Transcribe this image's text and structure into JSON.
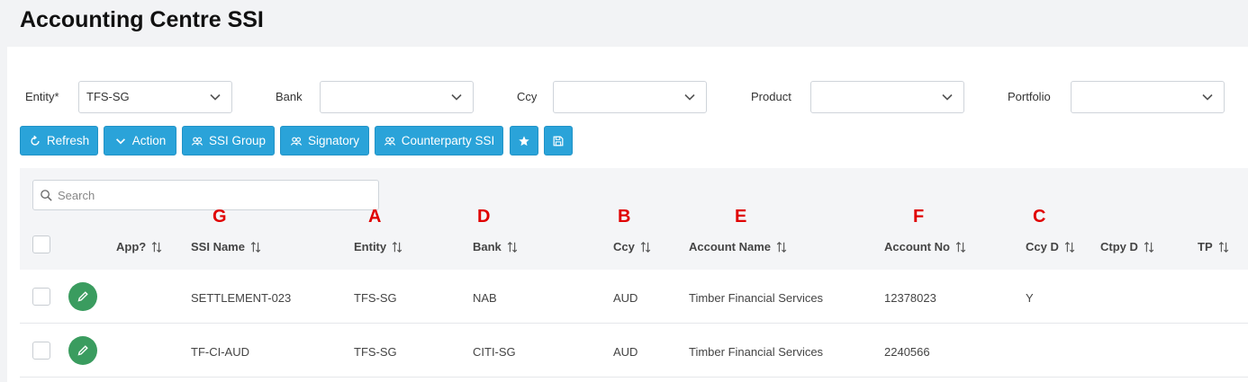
{
  "page": {
    "title": "Accounting Centre SSI"
  },
  "filters": {
    "entity": {
      "label": "Entity*",
      "value": "TFS-SG"
    },
    "bank": {
      "label": "Bank",
      "value": ""
    },
    "ccy": {
      "label": "Ccy",
      "value": ""
    },
    "product": {
      "label": "Product",
      "value": ""
    },
    "portfolio": {
      "label": "Portfolio",
      "value": ""
    }
  },
  "toolbar": {
    "refresh": "Refresh",
    "action": "Action",
    "ssi_group": "SSI Group",
    "signatory": "Signatory",
    "counterparty_ssi": "Counterparty SSI"
  },
  "search": {
    "placeholder": "Search"
  },
  "annotations": {
    "ssi_name": "G",
    "entity": "A",
    "bank": "D",
    "ccy": "B",
    "account_name": "E",
    "account_no": "F",
    "ccy_d": "C"
  },
  "table": {
    "columns": {
      "app": "App?",
      "ssi_name": "SSI Name",
      "entity": "Entity",
      "bank": "Bank",
      "ccy": "Ccy",
      "account_name": "Account Name",
      "account_no": "Account No",
      "ccy_d": "Ccy D",
      "ctpy_d": "Ctpy D",
      "tp": "TP"
    },
    "rows": [
      {
        "ssi_name": "SETTLEMENT-023",
        "entity": "TFS-SG",
        "bank": "NAB",
        "ccy": "AUD",
        "account_name": "Timber Financial Services",
        "account_no": "12378023",
        "ccy_d": "Y"
      },
      {
        "ssi_name": "TF-CI-AUD",
        "entity": "TFS-SG",
        "bank": "CITI-SG",
        "ccy": "AUD",
        "account_name": "Timber Financial Services",
        "account_no": "2240566",
        "ccy_d": ""
      }
    ]
  },
  "colors": {
    "primary_button": "#2aa3d9",
    "edit_button": "#3a9c5f",
    "annotation": "#e00000"
  },
  "icons": [
    "chevron-down-icon",
    "refresh-icon",
    "users-icon",
    "star-icon",
    "save-icon",
    "search-icon",
    "sort-icon",
    "pencil-icon"
  ]
}
